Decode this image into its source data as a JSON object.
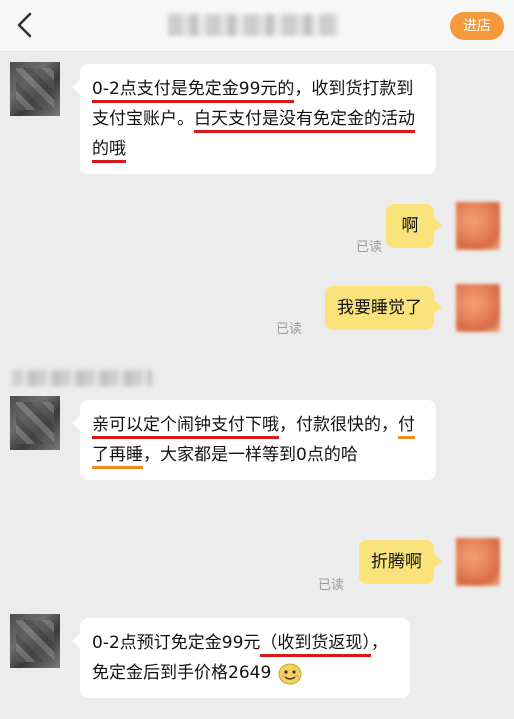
{
  "header": {
    "shop_button": "进店"
  },
  "messages": [
    {
      "from": "shop",
      "segments": [
        "0-2点支付是免定金99元的",
        "，收到货打款到支付宝账户。",
        "白天支付是没有免定金的活动的哦"
      ]
    },
    {
      "from": "me",
      "text": "啊",
      "status": "已读"
    },
    {
      "from": "me",
      "text": "我要睡觉了",
      "status": "已读"
    },
    {
      "from": "shop",
      "segments": [
        "亲可以定个闹钟支付下哦",
        "，付款很快的，",
        "付了再睡",
        "，大家都是一样等到0点的哈"
      ]
    },
    {
      "from": "me",
      "text": "折腾啊",
      "status": "已读"
    },
    {
      "from": "shop",
      "segments": [
        "0-2点预订免定金99元",
        "（收到货返现）",
        "，免定金后到手价格2649"
      ]
    }
  ],
  "colors": {
    "accent": "#f59a3c",
    "my_bubble": "#f9e37a",
    "underline_red": "#d91919",
    "underline_orange": "#f08c22"
  }
}
